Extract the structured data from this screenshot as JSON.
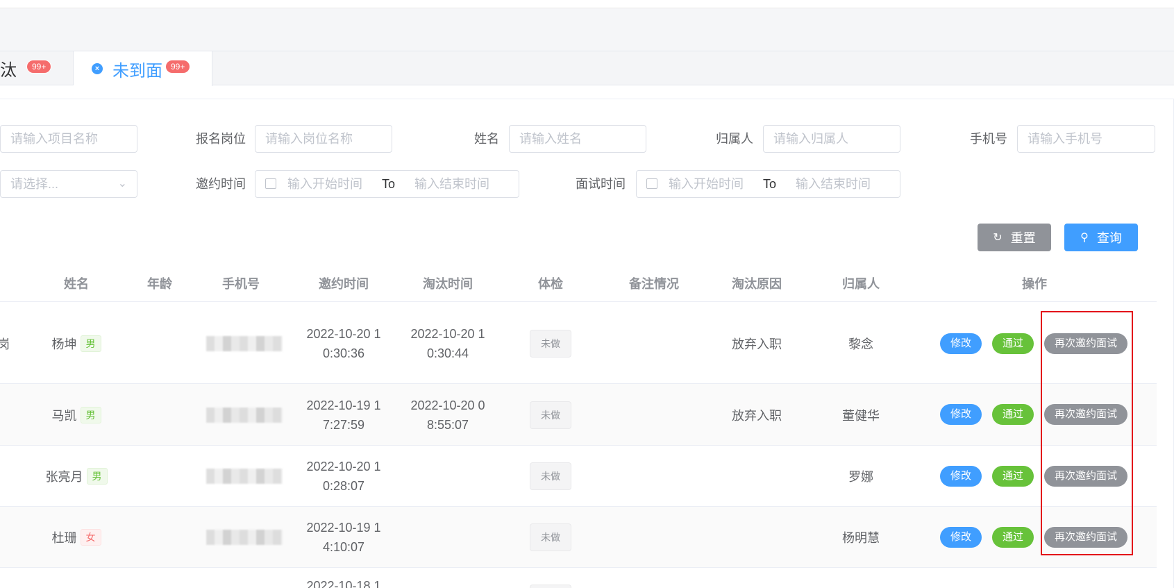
{
  "tabs": [
    {
      "label": "淘汰",
      "visible_label": "淘汰",
      "badge": "99+"
    },
    {
      "label": "未到面",
      "badge": "99+",
      "close_icon": "×"
    }
  ],
  "filters": {
    "project_placeholder": "请输入项目名称",
    "position_label": "报名岗位",
    "position_placeholder": "请输入岗位名称",
    "name_label": "姓名",
    "name_placeholder": "请输入姓名",
    "owner_label": "归属人",
    "owner_placeholder": "请输入归属人",
    "phone_label": "手机号",
    "phone_placeholder": "请输入手机号",
    "select_placeholder": "请选择...",
    "invite_time_label": "邀约时间",
    "interview_time_label": "面试时间",
    "start_placeholder": "输入开始时间",
    "end_placeholder": "输入结束时间",
    "range_separator": "To"
  },
  "buttons": {
    "reset": "重置",
    "query": "查询"
  },
  "table": {
    "columns": [
      "姓名",
      "年龄",
      "手机号",
      "邀约时间",
      "淘汰时间",
      "体检",
      "备注情况",
      "淘汰原因",
      "归属人",
      "操作"
    ],
    "rows": [
      {
        "left_fragment": "岗",
        "name": "杨坤",
        "gender": "男",
        "invite_line1": "2022-10-20 1",
        "invite_line2": "0:30:36",
        "elim_line1": "2022-10-20 1",
        "elim_line2": "0:30:44",
        "exam": "未做",
        "reason": "放弃入职",
        "owner": "黎念"
      },
      {
        "left_fragment": "",
        "name": "马凯",
        "gender": "男",
        "invite_line1": "2022-10-19 1",
        "invite_line2": "7:27:59",
        "elim_line1": "2022-10-20 0",
        "elim_line2": "8:55:07",
        "exam": "未做",
        "reason": "放弃入职",
        "owner": "董健华"
      },
      {
        "left_fragment": "",
        "name": "张亮月",
        "gender": "男",
        "invite_line1": "2022-10-20 1",
        "invite_line2": "0:28:07",
        "elim_line1": "",
        "elim_line2": "",
        "exam": "未做",
        "reason": "",
        "owner": "罗娜"
      },
      {
        "left_fragment": "",
        "name": "杜珊",
        "gender": "女",
        "invite_line1": "2022-10-19 1",
        "invite_line2": "4:10:07",
        "elim_line1": "",
        "elim_line2": "",
        "exam": "未做",
        "reason": "",
        "owner": "杨明慧"
      },
      {
        "left_fragment": "",
        "name": "",
        "gender": "",
        "invite_line1": "2022-10-18 1",
        "invite_line2": "",
        "elim_line1": "",
        "elim_line2": "",
        "exam": "",
        "reason": "",
        "owner": ""
      }
    ],
    "actions": {
      "edit": "修改",
      "pass": "通过",
      "reinvite": "再次邀约面试"
    }
  },
  "colors": {
    "primary": "#409eff",
    "success": "#67c23a",
    "info": "#909399",
    "danger": "#f56c6c",
    "highlight": "#e3131a"
  },
  "icons": [
    "close-circle-icon",
    "chevron-down-icon",
    "calendar-icon",
    "refresh-icon",
    "search-icon"
  ]
}
